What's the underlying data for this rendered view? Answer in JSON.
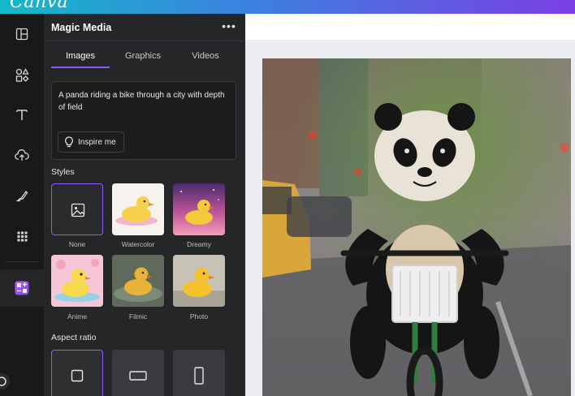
{
  "app": {
    "logo_text": "Canva"
  },
  "rail": {
    "items": [
      {
        "name": "design",
        "icon": "layout-icon"
      },
      {
        "name": "elements",
        "icon": "shapes-icon"
      },
      {
        "name": "text",
        "icon": "text-icon"
      },
      {
        "name": "uploads",
        "icon": "cloud-upload-icon"
      },
      {
        "name": "draw",
        "icon": "draw-icon"
      },
      {
        "name": "apps",
        "icon": "apps-grid-icon"
      },
      {
        "name": "magic-media",
        "icon": "magic-media-icon",
        "active": true
      }
    ]
  },
  "panel": {
    "title": "Magic Media",
    "more_label": "•••",
    "tabs": [
      {
        "label": "Images",
        "active": true
      },
      {
        "label": "Graphics",
        "active": false
      },
      {
        "label": "Videos",
        "active": false
      }
    ],
    "prompt": "A panda riding a bike through a city with depth of field",
    "inspire_label": "Inspire me",
    "styles_label": "Styles",
    "styles": [
      {
        "label": "None",
        "selected": true
      },
      {
        "label": "Watercolor"
      },
      {
        "label": "Dreamy"
      },
      {
        "label": "Anime"
      },
      {
        "label": "Filmic"
      },
      {
        "label": "Photo"
      }
    ],
    "aspect_label": "Aspect ratio",
    "aspect_ratios": [
      {
        "name": "square",
        "selected": true
      },
      {
        "name": "landscape"
      },
      {
        "name": "portrait"
      }
    ]
  },
  "colors": {
    "accent": "#8b5cf6",
    "panel_bg": "#252627",
    "rail_bg": "#18191b",
    "canvas_bg": "#ebecf0"
  }
}
